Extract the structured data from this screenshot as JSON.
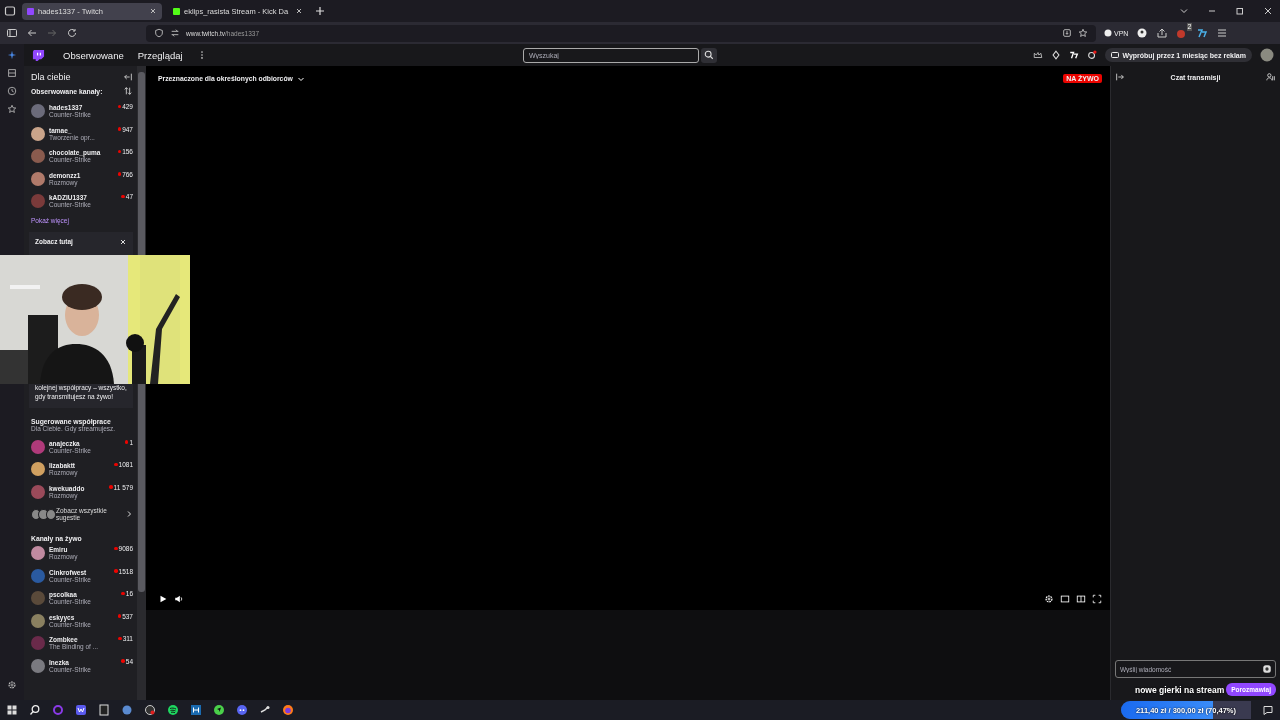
{
  "browser": {
    "tabs": [
      {
        "title": "hades1337 - Twitch",
        "selected": true
      },
      {
        "title": "eklips_rasista Stream - Kick Da",
        "selected": false
      }
    ],
    "url_domain": "www.twitch.tv",
    "url_path": "/hades1337",
    "vpn": "VPN",
    "extension_badge": "2"
  },
  "nav": {
    "links": [
      "Obserwowane",
      "Przeglądaj"
    ],
    "search": {
      "placeholder": "Wyszukaj"
    },
    "promo": "Wypróbuj przez 1 miesiąc bez reklam"
  },
  "sidebar": {
    "title": "Dla ciebie",
    "followed": {
      "title": "Obserwowane kanały:",
      "more": "Pokaż więcej",
      "channels": [
        {
          "name": "hades1337",
          "category": "Counter-Strike",
          "viewers": "429"
        },
        {
          "name": "tamae_",
          "category": "Tworzenie opr...",
          "viewers": "947"
        },
        {
          "name": "chocolate_puma",
          "category": "Counter-Strike",
          "viewers": "156"
        },
        {
          "name": "demonzz1",
          "category": "Rozmowy",
          "viewers": "766"
        },
        {
          "name": "kADZIU1337",
          "category": "Counter-Strike",
          "viewers": "47"
        }
      ]
    },
    "card": {
      "title": "Zobacz tutaj",
      "text": "kolejnej współpracy – wszystko, gdy transmitujesz na żywo!"
    },
    "suggested": {
      "title": "Sugerowane współprace",
      "subtitle": "Dla Ciebie. Gdy streamujesz.",
      "see_all": "Zobacz wszystkie sugestie",
      "channels": [
        {
          "name": "anajeczka",
          "category": "Counter-Strike",
          "viewers": "1"
        },
        {
          "name": "lizabaktt",
          "category": "Rozmowy",
          "viewers": "1081"
        },
        {
          "name": "kwekuaddo",
          "category": "Rozmowy",
          "viewers": "11 579"
        }
      ]
    },
    "live": {
      "title": "Kanały na żywo",
      "channels": [
        {
          "name": "Emiru",
          "category": "Rozmowy",
          "viewers": "9086"
        },
        {
          "name": "Cinkrofwest",
          "category": "Counter-Strike",
          "viewers": "1518"
        },
        {
          "name": "pscolkaa",
          "category": "Counter-Strike",
          "viewers": "16"
        },
        {
          "name": "eskyycs",
          "category": "Counter-Strike",
          "viewers": "537"
        },
        {
          "name": "Zombkee",
          "category": "The Binding of ...",
          "viewers": "311"
        },
        {
          "name": "Inezka",
          "category": "Counter-Strike",
          "viewers": "54"
        }
      ]
    }
  },
  "player": {
    "audience_label": "Przeznaczone dla określonych odbiorców",
    "live_badge": "NA ŻYWO"
  },
  "chat": {
    "title": "Czat transmisji",
    "input": {
      "placeholder": "Wyślij wiadomość"
    },
    "button": "Porozmawiaj"
  },
  "overlay": {
    "caption": "nowe gierki na stream",
    "goal": {
      "text": "211,40 zł / 300,00 zł (70,47%)",
      "level": 0.7047
    }
  }
}
